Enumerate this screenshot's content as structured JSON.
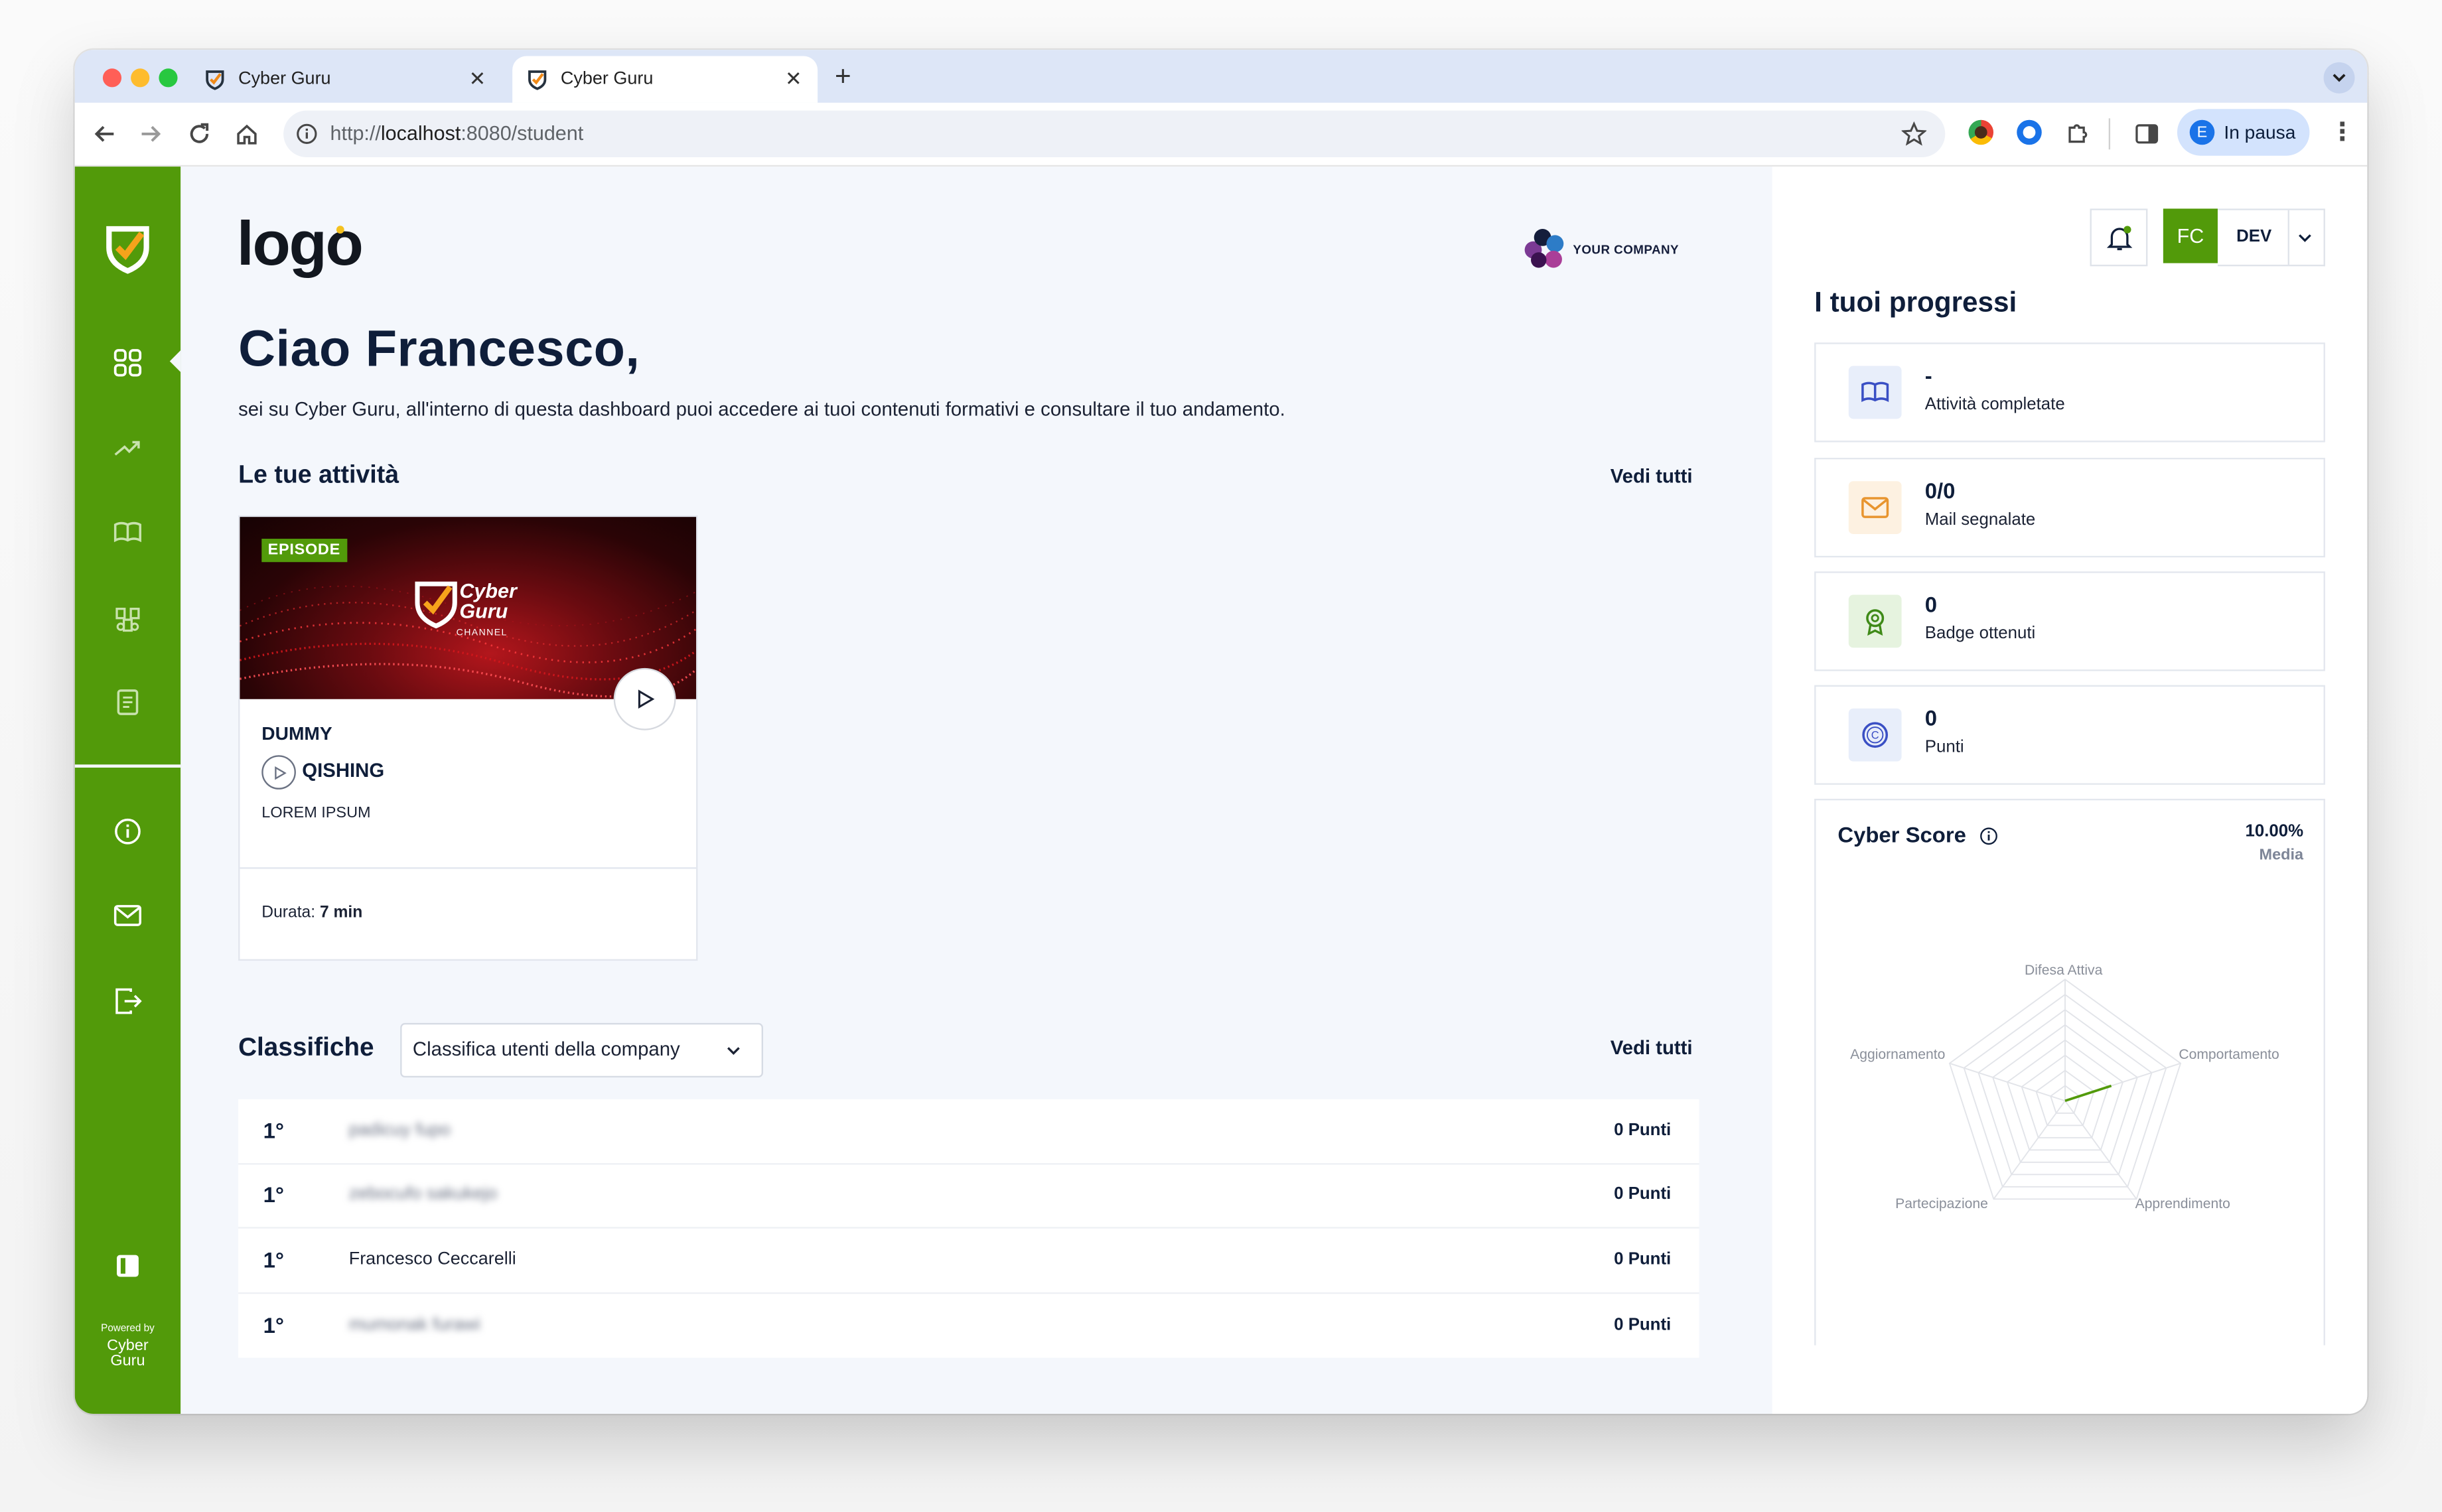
{
  "browser": {
    "tabs": [
      {
        "title": "Cyber Guru",
        "active": false
      },
      {
        "title": "Cyber Guru",
        "active": true
      }
    ],
    "url_prefix": "http://",
    "url_host": "localhost",
    "url_rest": ":8080/student",
    "profile_initial": "E",
    "profile_label": "In pausa"
  },
  "sidebar": {
    "items": [
      "dashboard-icon",
      "trending-icon",
      "book-icon",
      "trophy-icon",
      "document-icon"
    ],
    "bottom_items": [
      "info-icon",
      "mail-icon",
      "logout-icon",
      "sidebar-toggle-icon"
    ],
    "powered_by": "Powered by",
    "brand_line1": "Cyber",
    "brand_line2": "Guru",
    "accent": "#529a0a"
  },
  "header": {
    "logo_text": "logo",
    "company_name": "YOUR COMPANY"
  },
  "main": {
    "greeting": "Ciao Francesco,",
    "subtitle": "sei su Cyber Guru, all'interno di questa dashboard puoi accedere ai tuoi contenuti formativi e consultare il tuo andamento.",
    "activities_title": "Le tue attività",
    "see_all": "Vedi tutti",
    "activity_card": {
      "badge": "EPISODE",
      "thumb_brand_line1": "Cyber",
      "thumb_brand_line2": "Guru",
      "thumb_brand_sub": "CHANNEL",
      "category": "DUMMY",
      "title": "QISHING",
      "description": "LOREM IPSUM",
      "duration_label": "Durata:",
      "duration_value": "7 min"
    },
    "rankings_title": "Classifiche",
    "rankings_select": "Classifica utenti della company",
    "rankings_see_all": "Vedi tutti",
    "rankings": [
      {
        "pos": "1°",
        "name": "padicuy fupo",
        "points": "0 Punti",
        "blurred": true
      },
      {
        "pos": "1°",
        "name": "zebocufo sakukejo",
        "points": "0 Punti",
        "blurred": true
      },
      {
        "pos": "1°",
        "name": "Francesco Ceccarelli",
        "points": "0 Punti",
        "blurred": false
      },
      {
        "pos": "1°",
        "name": "mumonak furawi",
        "points": "0 Punti",
        "blurred": true
      }
    ]
  },
  "right_panel": {
    "user_initials": "FC",
    "env_label": "DEV",
    "progress_title": "I tuoi progressi",
    "stats": [
      {
        "value": "-",
        "label": "Attività completate",
        "icon": "book-icon",
        "bg": "#e8eefa",
        "color": "#3a4fc4"
      },
      {
        "value": "0/0",
        "label": "Mail segnalate",
        "icon": "mail-icon",
        "bg": "#fdf1e1",
        "color": "#e8952f"
      },
      {
        "value": "0",
        "label": "Badge ottenuti",
        "icon": "badge-icon",
        "bg": "#e6f3df",
        "color": "#3f8a18"
      },
      {
        "value": "0",
        "label": "Punti",
        "icon": "coin-icon",
        "bg": "#e8eefa",
        "color": "#3a4fc4"
      }
    ],
    "cyber_score": {
      "title": "Cyber Score",
      "value": "10.00%",
      "sublabel": "Media",
      "axes": [
        "Difesa Attiva",
        "Comportamento",
        "Apprendimento",
        "Partecipazione",
        "Aggiornamento"
      ],
      "values": [
        0,
        0.4,
        0,
        0,
        0
      ],
      "series_color": "#529a0a"
    }
  }
}
